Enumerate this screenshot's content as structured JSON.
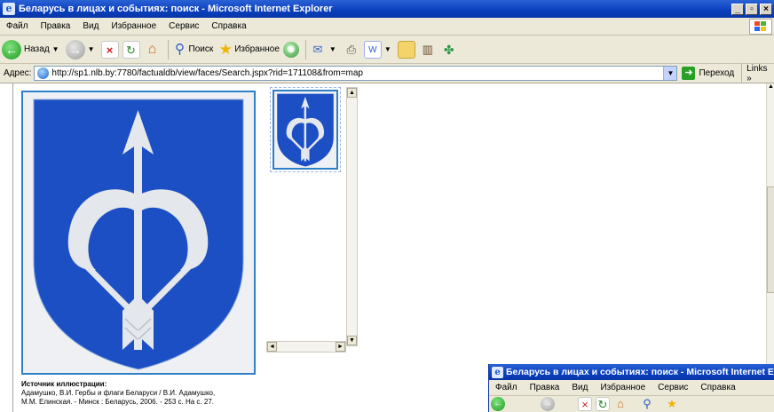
{
  "window": {
    "title": "Беларусь в лицах и событиях: поиск - Microsoft Internet Explorer",
    "controls": [
      "_",
      " ",
      "×"
    ]
  },
  "menu": [
    "Файл",
    "Правка",
    "Вид",
    "Избранное",
    "Сервис",
    "Справка"
  ],
  "toolbar": {
    "back_label": "Назад",
    "search_label": "Поиск",
    "favorites_label": "Избранное"
  },
  "address": {
    "label": "Адрес:",
    "url": "http://sp1.nlb.by:7780/factualdb/view/faces/Search.jspx?rid=171108&from=map",
    "go_label": "Переход",
    "links_label": "Links"
  },
  "caption": {
    "heading": "Источник иллюстрации:",
    "line1": "Адамушко, В.И. Гербы и флаги Беларуси / В.И. Адамушко,",
    "line2": "М.М. Елинская. - Минск : Беларусь, 2006. - 253 с. На с. 27."
  },
  "second_window": {
    "title": "Беларусь в лицах и событиях: поиск - Microsoft Internet E",
    "menu": [
      "Файл",
      "Правка",
      "Вид",
      "Избранное",
      "Сервис",
      "Справка"
    ]
  },
  "colors": {
    "shield_blue": "#1d4fc4",
    "emblem_white": "#e4e7ec",
    "frame_blue": "#2f7fc7",
    "titlebar_blue": "#0a3fbd"
  },
  "icons": [
    "ie-app-icon",
    "back-icon",
    "forward-icon",
    "stop-icon",
    "refresh-icon",
    "home-icon",
    "search-icon",
    "favorites-star-icon",
    "media-icon",
    "history-icon",
    "mail-icon",
    "print-icon",
    "edit-icon",
    "folder-icon",
    "messenger-icon",
    "go-arrow-icon",
    "windows-logo-icon"
  ]
}
